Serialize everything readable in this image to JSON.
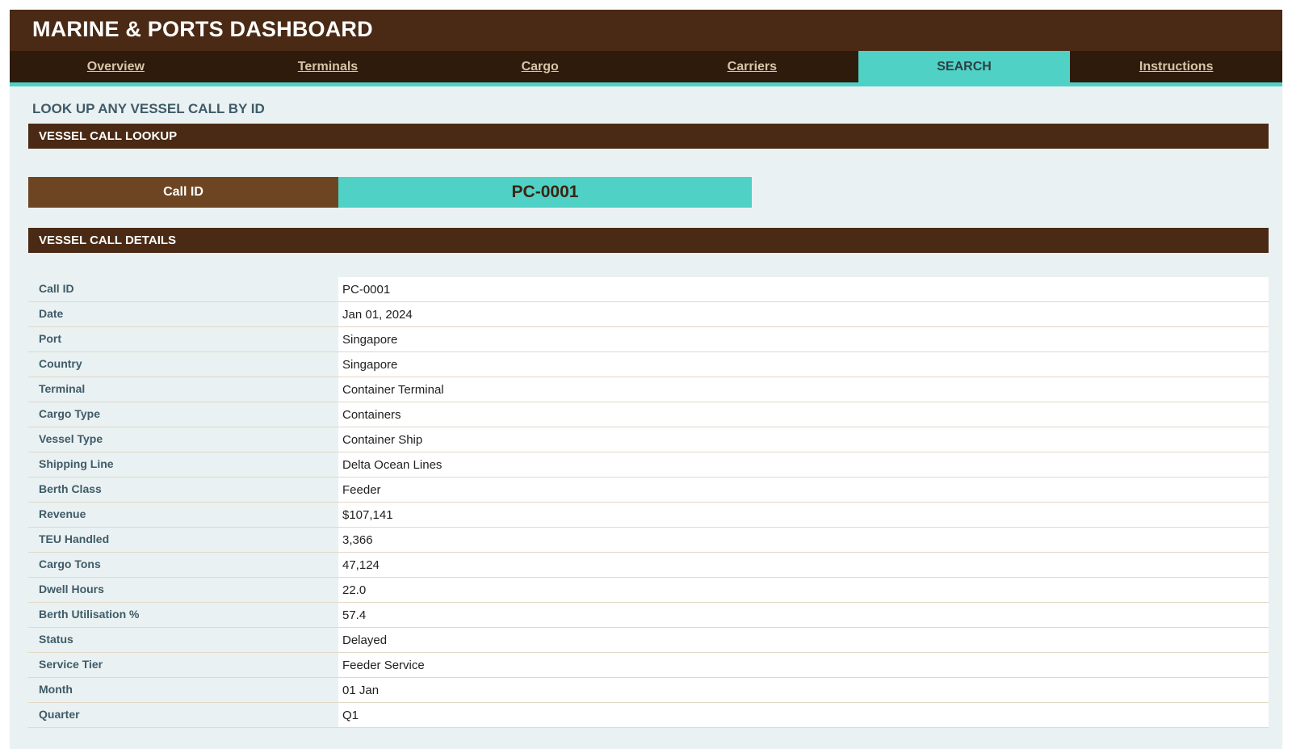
{
  "header": {
    "title": "MARINE & PORTS DASHBOARD"
  },
  "nav": {
    "tabs": [
      {
        "label": "Overview",
        "active": false
      },
      {
        "label": "Terminals",
        "active": false
      },
      {
        "label": "Cargo",
        "active": false
      },
      {
        "label": "Carriers",
        "active": false
      },
      {
        "label": "SEARCH",
        "active": true
      },
      {
        "label": "Instructions",
        "active": false
      }
    ]
  },
  "page": {
    "subtitle": "LOOK UP ANY VESSEL CALL BY ID"
  },
  "lookup": {
    "section_title": "VESSEL CALL LOOKUP",
    "label": "Call ID",
    "value": "PC-0001"
  },
  "details": {
    "section_title": "VESSEL CALL DETAILS",
    "rows": [
      {
        "label": "Call ID",
        "value": "PC-0001"
      },
      {
        "label": "Date",
        "value": "Jan 01, 2024"
      },
      {
        "label": "Port",
        "value": "Singapore"
      },
      {
        "label": "Country",
        "value": "Singapore"
      },
      {
        "label": "Terminal",
        "value": "Container Terminal"
      },
      {
        "label": "Cargo Type",
        "value": "Containers"
      },
      {
        "label": "Vessel Type",
        "value": "Container Ship"
      },
      {
        "label": "Shipping Line",
        "value": "Delta Ocean Lines"
      },
      {
        "label": "Berth Class",
        "value": "Feeder"
      },
      {
        "label": "Revenue",
        "value": "$107,141"
      },
      {
        "label": "TEU Handled",
        "value": "3,366"
      },
      {
        "label": "Cargo Tons",
        "value": "47,124"
      },
      {
        "label": "Dwell Hours",
        "value": "22.0"
      },
      {
        "label": "Berth Utilisation %",
        "value": "57.4"
      },
      {
        "label": "Status",
        "value": "Delayed"
      },
      {
        "label": "Service Tier",
        "value": "Feeder Service"
      },
      {
        "label": "Month",
        "value": "01 Jan"
      },
      {
        "label": "Quarter",
        "value": "Q1"
      }
    ]
  },
  "colors": {
    "header_brown": "#4a2a14",
    "nav_dark": "#2f1b0c",
    "accent_teal": "#4fd1c5",
    "label_brown": "#6e4522",
    "panel_bg": "#e9f1f2"
  }
}
